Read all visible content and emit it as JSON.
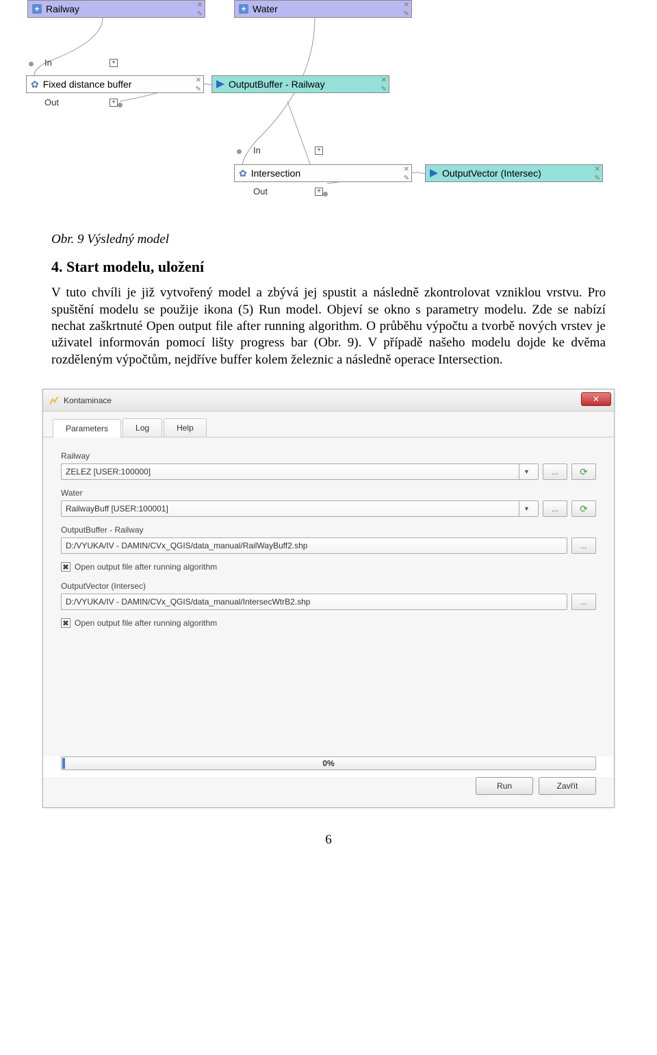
{
  "diagram": {
    "railway": "Railway",
    "water": "Water",
    "fixedBuffer": "Fixed distance buffer",
    "outputBuffer": "OutputBuffer - Railway",
    "intersection": "Intersection",
    "outputVector": "OutputVector (Intersec)",
    "in": "In",
    "out": "Out"
  },
  "caption": "Obr. 9 Výsledný model",
  "heading": "4. Start modelu, uložení",
  "paragraph": "V tuto chvíli je již vytvořený model a zbývá jej spustit a následně zkontrolovat vzniklou vrstvu. Pro spuštění modelu se použije ikona (5) Run model. Objeví se okno s parametry modelu. Zde se nabízí nechat zaškrtnuté Open output file after running algorithm. O průběhu výpočtu a tvorbě nových vrstev je uživatel informován pomocí lišty progress bar (Obr. 9). V případě našeho modelu dojde ke dvěma rozděleným výpočtům, nejdříve buffer kolem železnic a následně operace Intersection.",
  "dialog": {
    "title": "Kontaminace",
    "tabs": {
      "parameters": "Parameters",
      "log": "Log",
      "help": "Help"
    },
    "labels": {
      "railway": "Railway",
      "water": "Water",
      "outputBuffer": "OutputBuffer - Railway",
      "outputVector": "OutputVector (Intersec)"
    },
    "values": {
      "railway": "ZELEZ [USER:100000]",
      "water": "RailwayBuff [USER:100001]",
      "outputBuffer": "D:/VYUKA/IV - DAMIN/CVx_QGIS/data_manual/RailWayBuff2.shp",
      "outputVector": "D:/VYUKA/IV - DAMIN/CVx_QGIS/data_manual/IntersecWtrB2.shp"
    },
    "checkboxLabel": "Open output file after running algorithm",
    "browse": "...",
    "progress": "0%",
    "run": "Run",
    "close": "Zavřít"
  },
  "pageNumber": "6"
}
